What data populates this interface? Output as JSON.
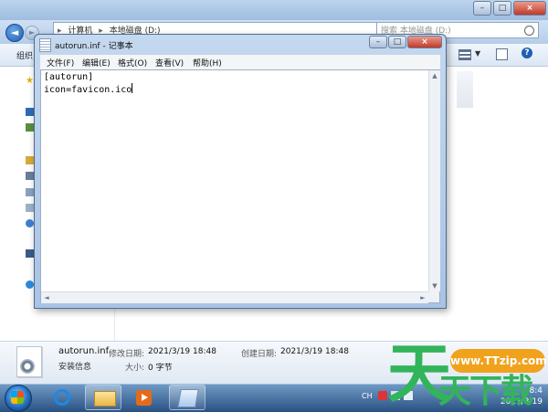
{
  "explorer": {
    "address_parts": [
      "计算机",
      "本地磁盘 (D:)"
    ],
    "search_placeholder": "搜索 本地磁盘 (D:)",
    "organize_label": "组织",
    "details": {
      "file_name": "autorun.inf",
      "modified_label": "修改日期:",
      "modified_value": "2021/3/19 18:48",
      "created_label": "创建日期:",
      "created_value": "2021/3/19 18:48",
      "type_label": "安装信息",
      "size_label": "大小:",
      "size_value": "0 字节"
    }
  },
  "notepad": {
    "title": "autorun.inf - 记事本",
    "menu": [
      "文件(F)",
      "编辑(E)",
      "格式(O)",
      "查看(V)",
      "帮助(H)"
    ],
    "content_line1": "[autorun]",
    "content_line2": "icon=favicon.ico"
  },
  "taskbar": {
    "tray_lang": "CH",
    "clock_time": "8:4",
    "clock_date": "2021/3/19"
  },
  "watermark": {
    "char1": "天",
    "url": "www.TTzip.com",
    "chars2": "天下载"
  },
  "colors": {
    "watermark_green": "#32b45a",
    "watermark_orange": "#f0a21c",
    "title_blue": "#a8c3e4"
  }
}
